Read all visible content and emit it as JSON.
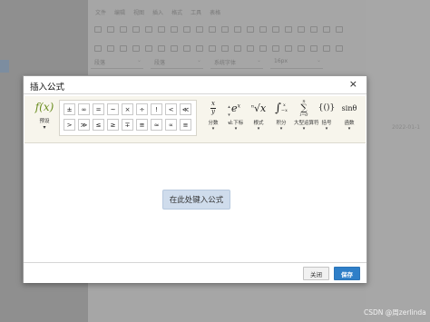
{
  "background": {
    "menubar": [
      "文件",
      "编辑",
      "视图",
      "插入",
      "格式",
      "工具",
      "表格"
    ],
    "selects": [
      "段落",
      "段落",
      "系统字体",
      "16px"
    ],
    "right_text": [
      "",
      "2022-01-1"
    ]
  },
  "dialog": {
    "title": "插入公式",
    "close_icon": "×",
    "preset": {
      "icon": "f(x)",
      "label": "预设",
      "caret": "▾"
    },
    "symbols": [
      [
        "±",
        "∞",
        "=",
        "~",
        "×",
        "÷",
        "!",
        "<",
        "≪"
      ],
      [
        ">",
        "≫",
        "≤",
        "≥",
        "∓",
        "≅",
        "≈",
        "∝",
        "≡"
      ]
    ],
    "scroll": {
      "up": "▴",
      "down": "▾",
      "more": "▾"
    },
    "tools": [
      {
        "glyph": "x/y",
        "label": "分数",
        "caret": "▾"
      },
      {
        "glyph": "e^x",
        "label": "上下标",
        "caret": "▾"
      },
      {
        "glyph": "ⁿ√x",
        "label": "根式",
        "caret": "▾"
      },
      {
        "glyph": "∫",
        "label": "积分",
        "caret": "▾"
      },
      {
        "glyph": "∑",
        "label": "大型运算符",
        "caret": "▾"
      },
      {
        "glyph": "{()}",
        "label": "括号",
        "caret": "▾"
      },
      {
        "glyph": "sinθ",
        "label": "函数",
        "caret": "▾"
      }
    ],
    "placeholder": "在此处键入公式",
    "close_button": "关闭",
    "save_button": "保存"
  },
  "watermark": "CSDN @周zerlinda"
}
